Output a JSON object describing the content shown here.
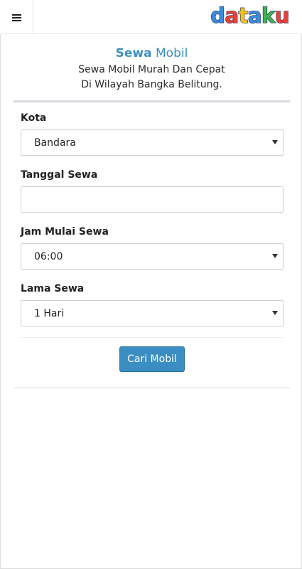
{
  "header": {
    "menu_icon": "hamburger-icon",
    "logo": {
      "letters": [
        {
          "ch": "d",
          "color": "#3b8be0"
        },
        {
          "ch": "a",
          "color": "#e8413a"
        },
        {
          "ch": "t",
          "color": "#f4c21f"
        },
        {
          "ch": "a",
          "color": "#3b8be0"
        },
        {
          "ch": "k",
          "color": "#3fb34f"
        },
        {
          "ch": "u",
          "color": "#e8413a"
        }
      ]
    }
  },
  "hero": {
    "title_bold": "Sewa",
    "title_rest": " Mobil",
    "subtitle_line1": "Sewa Mobil Murah Dan Cepat",
    "subtitle_line2": "Di Wilayah Bangka Belitung."
  },
  "form": {
    "kota": {
      "label": "Kota",
      "value": "Bandara"
    },
    "tanggal": {
      "label": "Tanggal Sewa",
      "value": ""
    },
    "jam": {
      "label": "Jam Mulai Sewa",
      "value": "06:00"
    },
    "lama": {
      "label": "Lama Sewa",
      "value": "1 Hari"
    },
    "submit_label": "Cari Mobil"
  },
  "colors": {
    "accent": "#3a8ec2",
    "title": "#3a8fc0"
  }
}
